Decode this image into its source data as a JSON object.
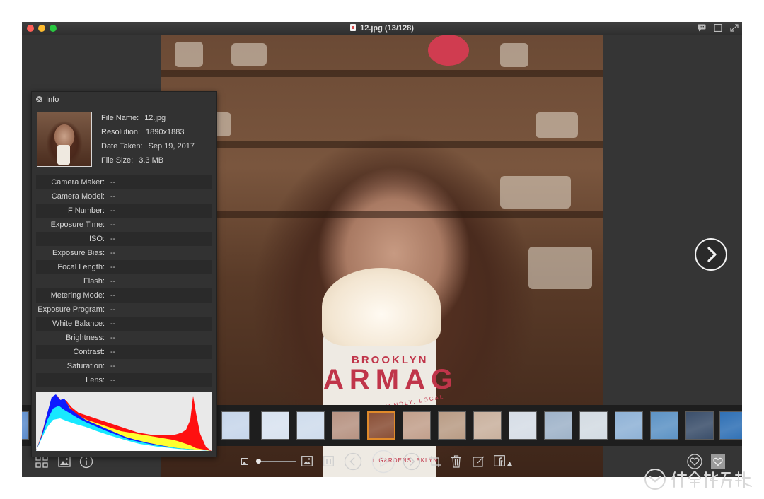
{
  "window": {
    "title": "12.jpg (13/128)"
  },
  "info_panel": {
    "header": "Info",
    "meta": [
      {
        "label": "File Name:",
        "value": "12.jpg"
      },
      {
        "label": "Resolution:",
        "value": "1890x1883"
      },
      {
        "label": "Date Taken:",
        "value": "Sep 19, 2017"
      },
      {
        "label": "File Size:",
        "value": "3.3 MB"
      }
    ],
    "exif": [
      {
        "label": "Camera Maker:",
        "value": "--"
      },
      {
        "label": "Camera Model:",
        "value": "--"
      },
      {
        "label": "F Number:",
        "value": "--"
      },
      {
        "label": "Exposure Time:",
        "value": "--"
      },
      {
        "label": "ISO:",
        "value": "--"
      },
      {
        "label": "Exposure Bias:",
        "value": "--"
      },
      {
        "label": "Focal Length:",
        "value": "--"
      },
      {
        "label": "Flash:",
        "value": "--"
      },
      {
        "label": "Metering Mode:",
        "value": "--"
      },
      {
        "label": "Exposure Program:",
        "value": "--"
      },
      {
        "label": "White Balance:",
        "value": "--"
      },
      {
        "label": "Brightness:",
        "value": "--"
      },
      {
        "label": "Contrast:",
        "value": "--"
      },
      {
        "label": "Saturation:",
        "value": "--"
      },
      {
        "label": "Lens:",
        "value": "--"
      }
    ]
  },
  "photo": {
    "cup_text_1": "BROOKLYN",
    "cup_text_2": "ARMAG",
    "cup_text_3": "FRESH, FRIENDLY, LOCAL",
    "cup_text_4": "L GARDENS, BKLYN"
  },
  "filmstrip": {
    "selected_index": 5,
    "thumb_colors": [
      "#5f8fcf",
      "#c7d6ea",
      "#d9e3f0",
      "#cfdcec",
      "#b79382",
      "#8a4f36",
      "#c2a08c",
      "#b99c85",
      "#c9b19e",
      "#d6dde6",
      "#9fb3c9",
      "#d3dbe2",
      "#8fb2d6",
      "#5d93c5",
      "#3b4f6b",
      "#2f70b5"
    ]
  },
  "colors": {
    "selected_border": "#e08a2a",
    "window_bg": "#353535",
    "panel_bg": "#323232"
  },
  "toolbar": {
    "icons": [
      "grid-view-icon",
      "browse-photo-icon",
      "info-icon",
      "small-image-icon",
      "zoom-slider",
      "large-image-icon",
      "fit-window-icon",
      "previous-icon",
      "play-slideshow-icon",
      "next-icon",
      "crop-icon",
      "trash-icon",
      "edit-icon",
      "facebook-share-icon",
      "favorite-heart-icon",
      "favorites-filter-icon"
    ]
  }
}
